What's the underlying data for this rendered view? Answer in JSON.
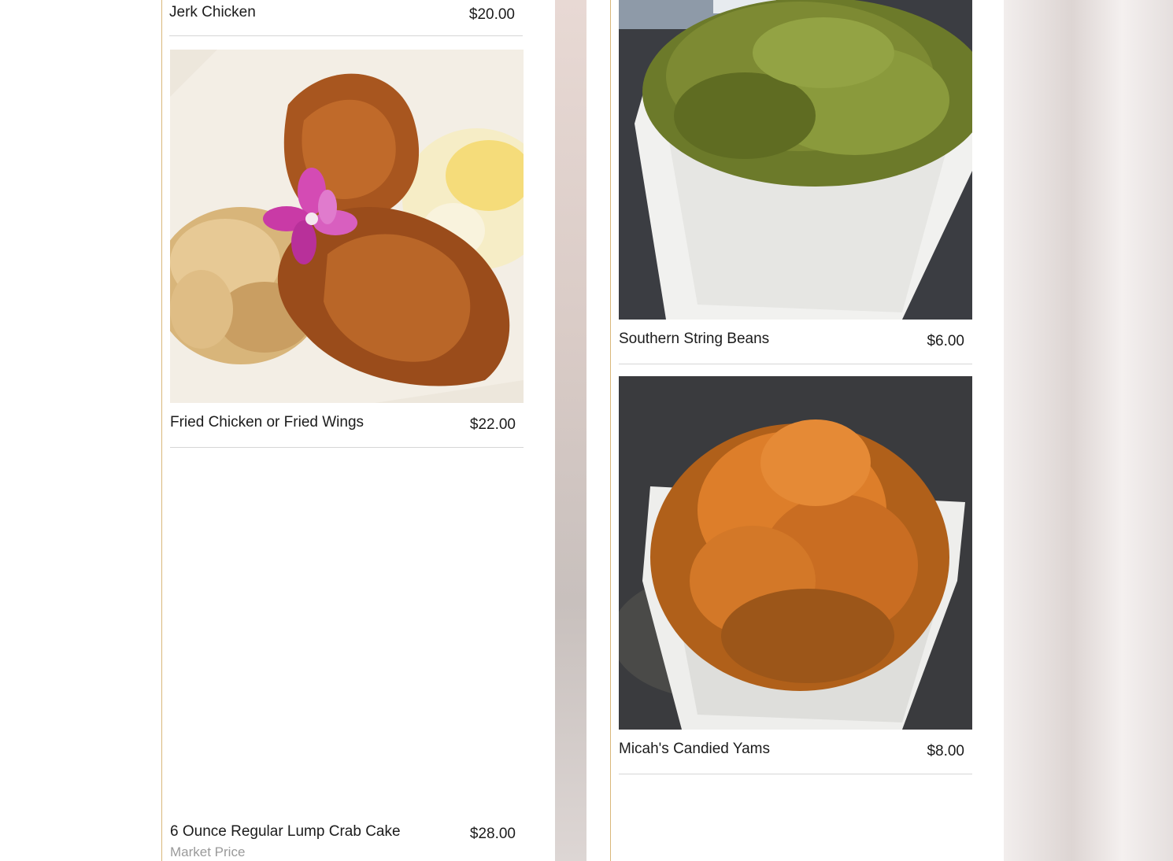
{
  "menu": {
    "left_column": [
      {
        "name": "Jerk Chicken",
        "price": "$20.00"
      },
      {
        "name": "Fried Chicken or Fried Wings",
        "price": "$22.00",
        "photo": "fried-chicken-plate"
      },
      {
        "name": "6 Ounce Regular Lump Crab Cake",
        "price": "$28.00",
        "note": "Market Price"
      }
    ],
    "right_column": [
      {
        "name": "Southern String Beans",
        "price": "$6.00",
        "photo": "string-beans-bowl"
      },
      {
        "name": "Micah's Candied Yams",
        "price": "$8.00",
        "photo": "candied-yams-bowl"
      }
    ]
  },
  "colors": {
    "accent_gold": "#d9b77a",
    "text": "#1b1b1b",
    "muted_text": "#9a9a9a",
    "divider": "#d6d6d6"
  }
}
